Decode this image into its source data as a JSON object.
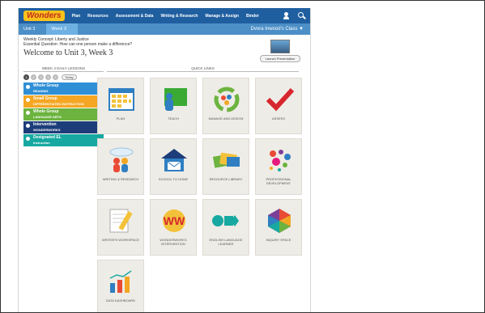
{
  "app": {
    "logo": "Wonders"
  },
  "nav": [
    "Plan",
    "Resources",
    "Assessment & Data",
    "Writing & Research",
    "Manage & Assign",
    "Binder"
  ],
  "breadcrumb": {
    "unit": "Unit 3",
    "week": "Week 3"
  },
  "class_selector": "Dvora Inwood's Class ▼",
  "header": {
    "concept": "Weekly Concept: Liberty and Justice",
    "question": "Essential Question: How can one person make a difference?",
    "title": "Welcome to Unit 3, Week 3",
    "launch_label": "Launch Presentation"
  },
  "lessons": {
    "heading": "WEEK 3 DAILY LESSONS",
    "days": [
      "1",
      "2",
      "3",
      "4",
      "5"
    ],
    "today_label": "Today",
    "items": [
      {
        "title": "Whole Group",
        "subtitle": "READING",
        "color": "#2f8fd6"
      },
      {
        "title": "Small Group",
        "subtitle": "DIFFERENTIATED INSTRUCTION",
        "color": "#f5a623"
      },
      {
        "title": "Whole Group",
        "subtitle": "LANGUAGE ARTS",
        "color": "#6cb33f"
      },
      {
        "title": "Intervention",
        "subtitle": "WONDERWORKS",
        "color": "#1d3d7a"
      },
      {
        "title": "Designated EL",
        "subtitle": "Instruction",
        "color": "#17a9a1"
      }
    ]
  },
  "quick_links": {
    "heading": "QUICK LINKS",
    "tiles": [
      {
        "label": "PLAN",
        "icon": "calendar-icon"
      },
      {
        "label": "TEACH",
        "icon": "teacher-board-icon"
      },
      {
        "label": "MANAGE AND ASSIGN",
        "icon": "recycle-people-icon"
      },
      {
        "label": "ASSESS",
        "icon": "checkmark-icon"
      },
      {
        "label": "WRITING & RESEARCH",
        "icon": "people-cloud-icon"
      },
      {
        "label": "SCHOOL TO HOME",
        "icon": "house-mail-icon"
      },
      {
        "label": "RESOURCE LIBRARY",
        "icon": "books-icon"
      },
      {
        "label": "PROFESSIONAL DEVELOPMENT",
        "icon": "dots-icon"
      },
      {
        "label": "WRITER'S WORKSPACE",
        "icon": "pencil-paper-icon"
      },
      {
        "label": "WONDERWORKS INTERVENTION",
        "icon": "ww-logo-icon"
      },
      {
        "label": "ENGLISH LANGUAGE LEARNER",
        "icon": "shapes-icon"
      },
      {
        "label": "INQUIRY SPACE",
        "icon": "hexagon-icon"
      },
      {
        "label": "DATA DASHBOARD",
        "icon": "bar-chart-icon"
      }
    ]
  }
}
